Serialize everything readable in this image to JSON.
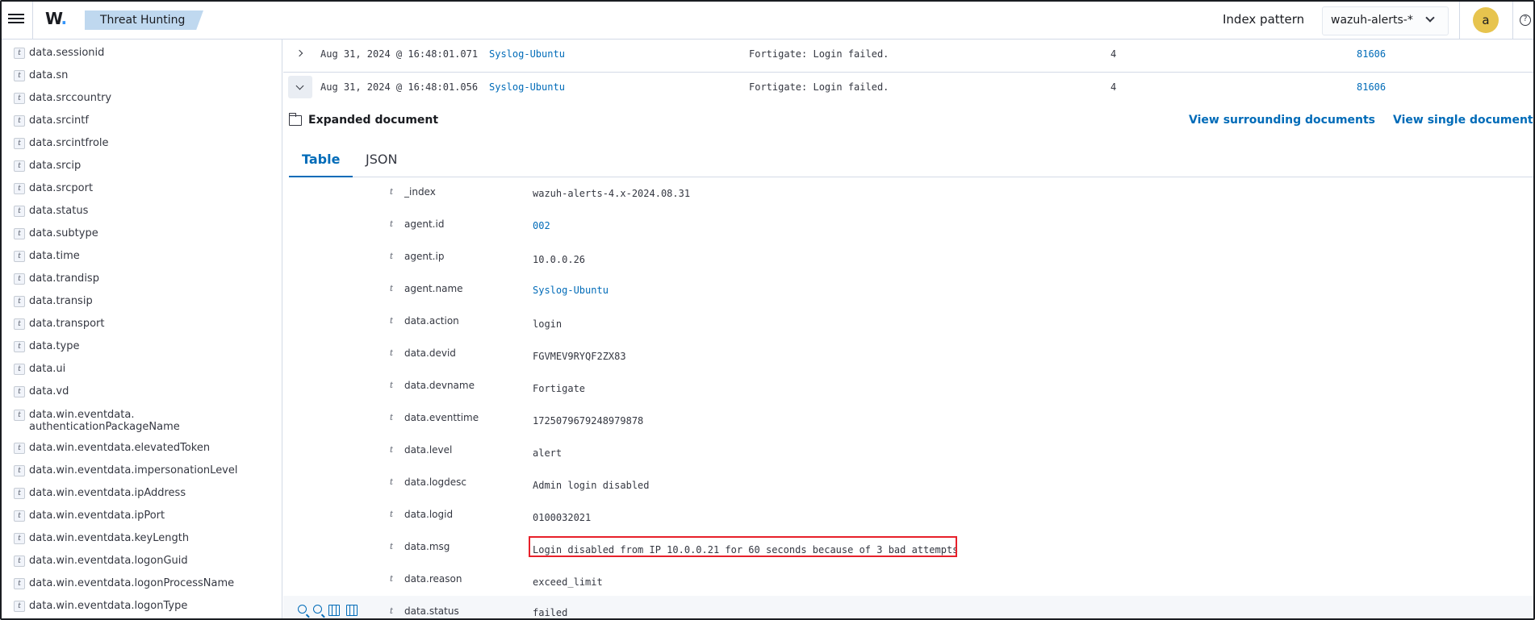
{
  "header": {
    "logo_text": "W",
    "logo_dot": ".",
    "breadcrumb": "Threat Hunting",
    "index_pattern_label": "Index pattern",
    "index_pattern_value": "wazuh-alerts-*",
    "avatar_letter": "a",
    "help_glyph": "?"
  },
  "sidebar": {
    "type_token": "t",
    "fields": [
      "data.sessionid",
      "data.sn",
      "data.srccountry",
      "data.srcintf",
      "data.srcintfrole",
      "data.srcip",
      "data.srcport",
      "data.status",
      "data.subtype",
      "data.time",
      "data.trandisp",
      "data.transip",
      "data.transport",
      "data.type",
      "data.ui",
      "data.vd",
      "data.win.eventdata.",
      "authenticationPackageName",
      "data.win.eventdata.elevatedToken",
      "data.win.eventdata.impersonationLevel",
      "data.win.eventdata.ipAddress",
      "data.win.eventdata.ipPort",
      "data.win.eventdata.keyLength",
      "data.win.eventdata.logonGuid",
      "data.win.eventdata.logonProcessName",
      "data.win.eventdata.logonType"
    ]
  },
  "rows": [
    {
      "time": "Aug 31, 2024 @ 16:48:01.071",
      "agent": "Syslog-Ubuntu",
      "description": "Fortigate: Login failed.",
      "level": "4",
      "rule_id": "81606"
    },
    {
      "time": "Aug 31, 2024 @ 16:48:01.056",
      "agent": "Syslog-Ubuntu",
      "description": "Fortigate: Login failed.",
      "level": "4",
      "rule_id": "81606"
    }
  ],
  "expanded": {
    "title": "Expanded document",
    "view_surrounding": "View surrounding documents",
    "view_single": "View single document",
    "tabs": [
      "Table",
      "JSON"
    ],
    "type_token": "t",
    "fields": [
      {
        "key": "_index",
        "value": "wazuh-alerts-4.x-2024.08.31"
      },
      {
        "key": "agent.id",
        "value": "002"
      },
      {
        "key": "agent.ip",
        "value": "10.0.0.26"
      },
      {
        "key": "agent.name",
        "value": "Syslog-Ubuntu"
      },
      {
        "key": "data.action",
        "value": "login"
      },
      {
        "key": "data.devid",
        "value": "FGVMEV9RYQF2ZX83"
      },
      {
        "key": "data.devname",
        "value": "Fortigate"
      },
      {
        "key": "data.eventtime",
        "value": "1725079679248979878"
      },
      {
        "key": "data.level",
        "value": "alert"
      },
      {
        "key": "data.logdesc",
        "value": "Admin login disabled"
      },
      {
        "key": "data.logid",
        "value": "0100032021"
      },
      {
        "key": "data.msg",
        "value": "Login disabled from IP 10.0.0.21 for 60 seconds because of 3 bad attempts"
      },
      {
        "key": "data.reason",
        "value": "exceed_limit"
      },
      {
        "key": "data.status",
        "value": "failed"
      }
    ]
  },
  "colors": {
    "link": "#006bb8",
    "highlight": "#e7202a",
    "breadcrumb_bg": "#bfd8ef",
    "avatar_bg": "#e7c44e"
  }
}
